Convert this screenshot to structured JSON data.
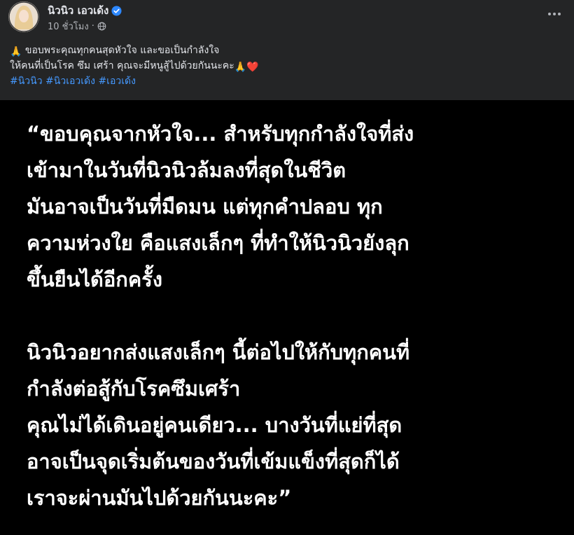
{
  "post": {
    "author": "นิวนิว เอวเด้ง",
    "time": "10 ชั่วโมง",
    "separator": "·",
    "icons": {
      "verified": "verified-badge-icon",
      "privacy": "globe-icon",
      "more": "more-options-icon"
    },
    "colors": {
      "hashtag": "#4599ff",
      "verified": "#2d88ff",
      "background": "#242526"
    }
  },
  "caption": {
    "line1": "ขอบพระคุณทุกคนสุดหัวใจ และขอเป็นกำลังใจ",
    "line2": "ให้คนที่เป็นโรค ซึม เศร้า คุณจะมีหนูสู้ไปด้วยกันนะคะ",
    "emoji_pray": "🙏",
    "emoji_heart": "❤️",
    "hashtags": [
      "#นิวนิว",
      "#นิวเอวเด้ง",
      "#เอวเด้ง"
    ]
  },
  "quote": {
    "lines1": [
      "“ขอบคุณจากหัวใจ... สำหรับทุกกำลังใจที่ส่ง",
      "เข้ามาในวันที่นิวนิวล้มลงที่สุดในชีวิต",
      "มันอาจเป็นวันที่มืดมน แต่ทุกคำปลอบ ทุก",
      "ความห่วงใย คือแสงเล็กๆ ที่ทำให้นิวนิวยังลุก",
      "ขึ้นยืนได้อีกครั้ง"
    ],
    "lines2": [
      "นิวนิวอยากส่งแสงเล็กๆ นี้ต่อไปให้กับทุกคนที่",
      "กำลังต่อสู้กับโรคซึมเศร้า",
      "คุณไม่ได้เดินอยู่คนเดียว... บางวันที่แย่ที่สุด",
      "อาจเป็นจุดเริ่มต้นของวันที่เข้มแข็งที่สุดก็ได้",
      "เราจะผ่านมันไปด้วยกันนะคะ”"
    ]
  }
}
